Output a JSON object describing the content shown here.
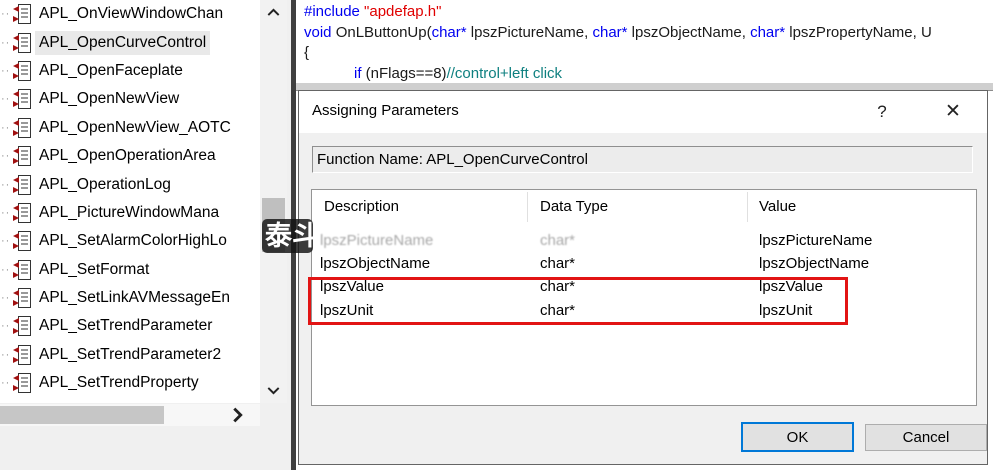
{
  "colors": {
    "accent_blue": "#0078d7",
    "highlight_red": "#e21414",
    "keyword_blue": "#0000f0",
    "string_red": "#e00000",
    "comment_teal": "#0f8080",
    "selection_gray": "#e9e9e9"
  },
  "left_panel": {
    "items": [
      {
        "label": "APL_OnViewWindowChan",
        "selected": false
      },
      {
        "label": "APL_OpenCurveControl",
        "selected": true
      },
      {
        "label": "APL_OpenFaceplate",
        "selected": false
      },
      {
        "label": "APL_OpenNewView",
        "selected": false
      },
      {
        "label": "APL_OpenNewView_AOTC",
        "selected": false
      },
      {
        "label": "APL_OpenOperationArea",
        "selected": false
      },
      {
        "label": "APL_OperationLog",
        "selected": false
      },
      {
        "label": "APL_PictureWindowMana",
        "selected": false
      },
      {
        "label": "APL_SetAlarmColorHighLo",
        "selected": false
      },
      {
        "label": "APL_SetFormat",
        "selected": false
      },
      {
        "label": "APL_SetLinkAVMessageEn",
        "selected": false
      },
      {
        "label": "APL_SetTrendParameter",
        "selected": false
      },
      {
        "label": "APL_SetTrendParameter2",
        "selected": false
      },
      {
        "label": "APL_SetTrendProperty",
        "selected": false
      }
    ]
  },
  "code": {
    "lines": [
      [
        {
          "t": "#include ",
          "c": "kw"
        },
        {
          "t": "\"apdefap.h\"",
          "c": "str"
        }
      ],
      [
        {
          "t": "void ",
          "c": "kw"
        },
        {
          "t": "OnLButtonUp(",
          "c": "pl"
        },
        {
          "t": "char*",
          "c": "kw"
        },
        {
          "t": " lpszPictureName, ",
          "c": "pl"
        },
        {
          "t": "char*",
          "c": "kw"
        },
        {
          "t": " lpszObjectName, ",
          "c": "pl"
        },
        {
          "t": "char*",
          "c": "kw"
        },
        {
          "t": " lpszPropertyName, U",
          "c": "pl"
        }
      ],
      [
        {
          "t": "{",
          "c": "pl"
        }
      ],
      [
        {
          "t": "            ",
          "c": "pl"
        },
        {
          "t": "if",
          "c": "kw"
        },
        {
          "t": " (nFlags==8)",
          "c": "pl"
        },
        {
          "t": "//control+left click",
          "c": "cm"
        }
      ]
    ]
  },
  "dialog": {
    "title": "Assigning Parameters",
    "icons": {
      "help": "?",
      "close": "✕"
    },
    "function_name": "Function Name: APL_OpenCurveControl",
    "table": {
      "columns": [
        "Description",
        "Data Type",
        "Value"
      ],
      "rows": [
        {
          "description": "lpszPictureName",
          "data_type": "char*",
          "value": "lpszPictureName",
          "faded": true,
          "highlighted": false
        },
        {
          "description": "lpszObjectName",
          "data_type": "char*",
          "value": "lpszObjectName",
          "faded": false,
          "highlighted": false
        },
        {
          "description": "lpszValue",
          "data_type": "char*",
          "value": "lpszValue",
          "faded": false,
          "highlighted": true
        },
        {
          "description": "lpszUnit",
          "data_type": "char*",
          "value": "lpszUnit",
          "faded": false,
          "highlighted": true
        }
      ]
    },
    "buttons": {
      "ok": "OK",
      "cancel": "Cancel"
    }
  },
  "watermark": {
    "text": "泰斗"
  }
}
